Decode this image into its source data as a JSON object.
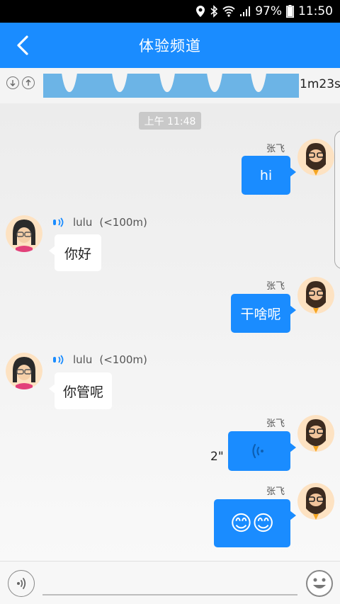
{
  "status_bar": {
    "battery": "97%",
    "time": "11:50"
  },
  "header": {
    "title": "体验频道"
  },
  "waveform": {
    "duration": "1m23s"
  },
  "chat": {
    "time_chip": "上午 11:48",
    "messages": [
      {
        "direction": "out",
        "sender": "张飞",
        "type": "text",
        "text": "hi"
      },
      {
        "direction": "in",
        "sender": "lulu",
        "distance": "(<100m)",
        "type": "text",
        "text": "你好"
      },
      {
        "direction": "out",
        "sender": "张飞",
        "type": "text",
        "text": "干啥呢"
      },
      {
        "direction": "in",
        "sender": "lulu",
        "distance": "(<100m)",
        "type": "text",
        "text": "你管呢"
      },
      {
        "direction": "out",
        "sender": "张飞",
        "type": "voice",
        "duration": "2\""
      },
      {
        "direction": "out",
        "sender": "张飞",
        "type": "emoji",
        "text": "😊😊"
      }
    ]
  },
  "colors": {
    "accent": "#1a8cff",
    "waveform": "#6cb4e6",
    "status_bg": "#000000"
  }
}
